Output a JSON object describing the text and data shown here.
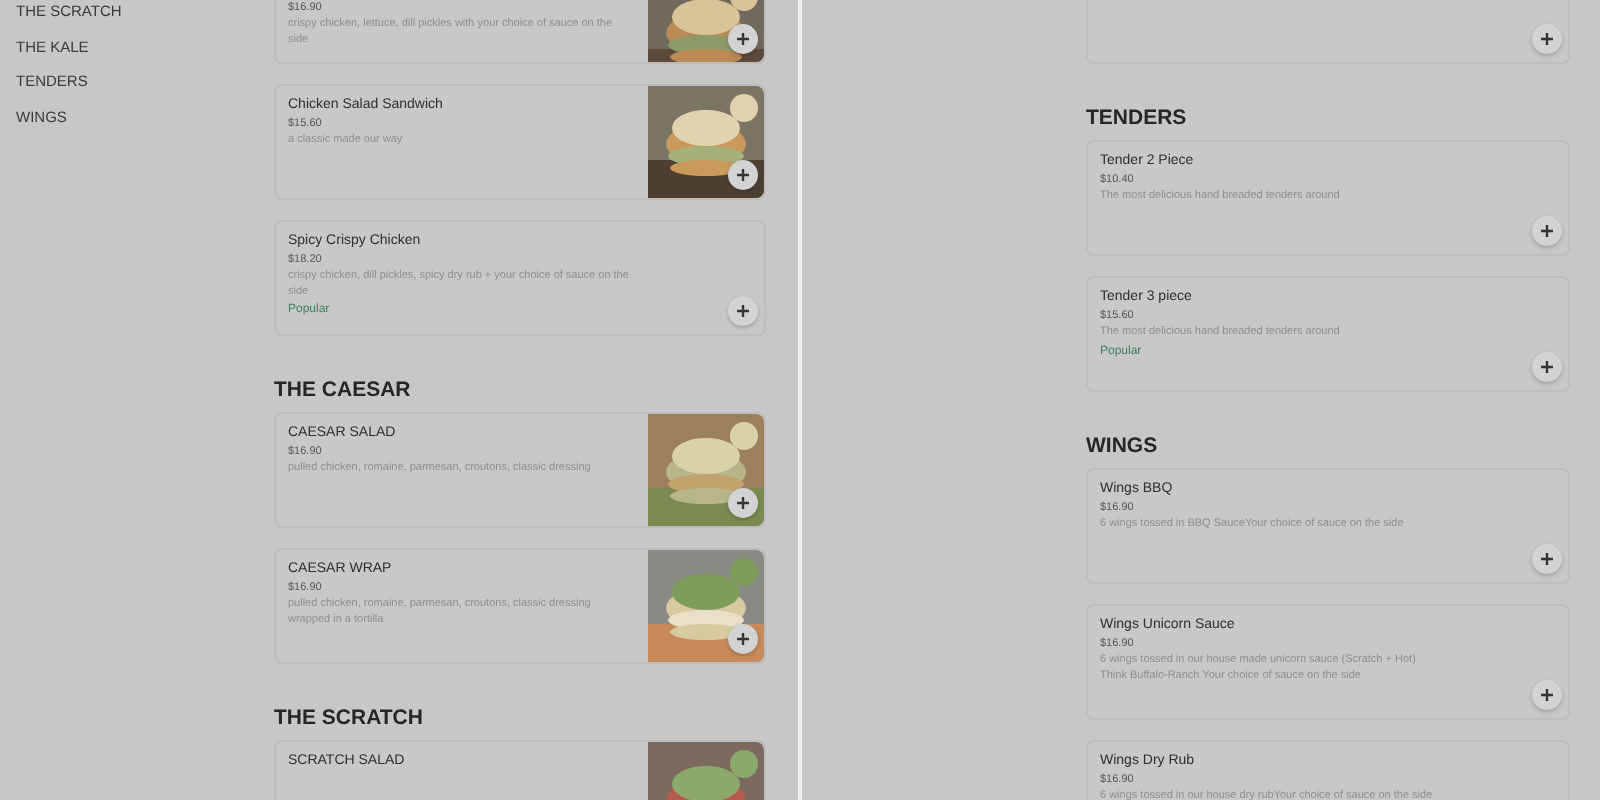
{
  "panes": [
    {
      "sidebar": [
        "THE SCRATCH",
        "THE KALE",
        "TENDERS",
        "WINGS"
      ],
      "sections": [
        {
          "items": [
            {
              "kind": "partial",
              "add_button": true,
              "price": "$16.90",
              "description": "crispy chicken, lettuce, dill pickles with your choice of sauce on the side"
            },
            {
              "kind": "full",
              "add_button": true,
              "name": "Chicken Salad Sandwich",
              "price": "$15.60",
              "description": "a classic made our way"
            },
            {
              "kind": "full",
              "add_button": true,
              "name": "Spicy Crispy Chicken",
              "price": "$18.20",
              "description": "crispy chicken, dill pickles, spicy dry rub + your choice of sauce on the side",
              "tag": "Popular"
            }
          ]
        },
        {
          "heading": "THE CAESAR",
          "items": [
            {
              "kind": "full",
              "add_button": true,
              "name": "CAESAR SALAD",
              "price": "$16.90",
              "description": "pulled chicken, romaine, parmesan, croutons, classic dressing"
            },
            {
              "kind": "full",
              "add_button": true,
              "name": "CAESAR WRAP",
              "price": "$16.90",
              "description": "pulled chicken, romaine, parmesan, croutons, classic dressing wrapped in a tortilla"
            }
          ]
        },
        {
          "heading": "THE SCRATCH",
          "items": [
            {
              "kind": "full",
              "add_button": false,
              "name": "SCRATCH SALAD"
            }
          ]
        }
      ]
    },
    {
      "sections": [
        {
          "items": [
            {
              "kind": "partial",
              "add_button": true
            }
          ]
        },
        {
          "heading": "TENDERS",
          "items": [
            {
              "kind": "full",
              "add_button": true,
              "name": "Tender 2 Piece",
              "price": "$10.40",
              "description": "The most delicious hand breaded tenders around"
            },
            {
              "kind": "full",
              "add_button": true,
              "name": "Tender 3 piece",
              "price": "$15.60",
              "description": "The most delicious hand breaded tenders around",
              "tag": "Popular"
            }
          ]
        },
        {
          "heading": "WINGS",
          "items": [
            {
              "kind": "full",
              "add_button": true,
              "name": "Wings BBQ",
              "price": "$16.90",
              "description": "6 wings tossed in BBQ SauceYour choice of sauce on the side"
            },
            {
              "kind": "full",
              "add_button": true,
              "name": "Wings Unicorn Sauce",
              "price": "$16.90",
              "description": "6 wings tossed in our house made unicorn sauce (Scratch + Hot) Think Buffalo-Ranch Your choice of sauce on the side"
            },
            {
              "kind": "full",
              "add_button": false,
              "name": "Wings Dry Rub",
              "price": "$16.90",
              "description": "6 wings tossed in our house dry rubYour choice of sauce on the side"
            }
          ]
        }
      ]
    }
  ]
}
